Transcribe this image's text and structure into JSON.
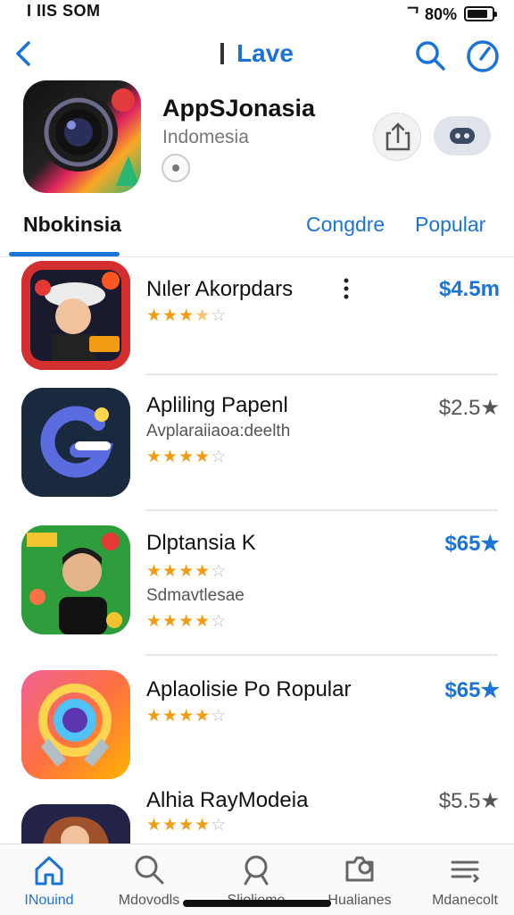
{
  "status_bar": {
    "left": "I IIS SOM",
    "right": "ᄀ 80%",
    "battery_level": 0.85
  },
  "nav": {
    "title": "Lave"
  },
  "header": {
    "name": "AppSJonasia",
    "subtitle": "Indomesia"
  },
  "tabs": [
    "Nbokinsia",
    "Congdre",
    "Popular"
  ],
  "apps": [
    {
      "title": "Nιler Akorpdars",
      "price": "$4.5m",
      "rating": 3.5,
      "price_style": "blue"
    },
    {
      "title": "Apliling Papenl",
      "subtitle": "Avplaraiiaoa:deelth",
      "price": "$2.5★",
      "rating": 4,
      "price_style": "gray"
    },
    {
      "title": "Dlptansia K",
      "subtitle": "Sdmavtlesae",
      "price": "$65★",
      "rating": 4,
      "rating2": 4,
      "price_style": "blue"
    },
    {
      "title": "Aplaolisie Po Ropular",
      "price": "$65★",
      "rating": 4,
      "price_style": "blue"
    },
    {
      "title": "Alhia RayModeia",
      "price": "$5.5★",
      "rating": 4,
      "price_style": "gray"
    }
  ],
  "tab_bar": [
    "INouind",
    "Mdovodls",
    "Sliolieme",
    "Hualianes",
    "Mdanecolt"
  ],
  "colors": {
    "accent": "#1a73d9",
    "star": "#f39c12"
  }
}
